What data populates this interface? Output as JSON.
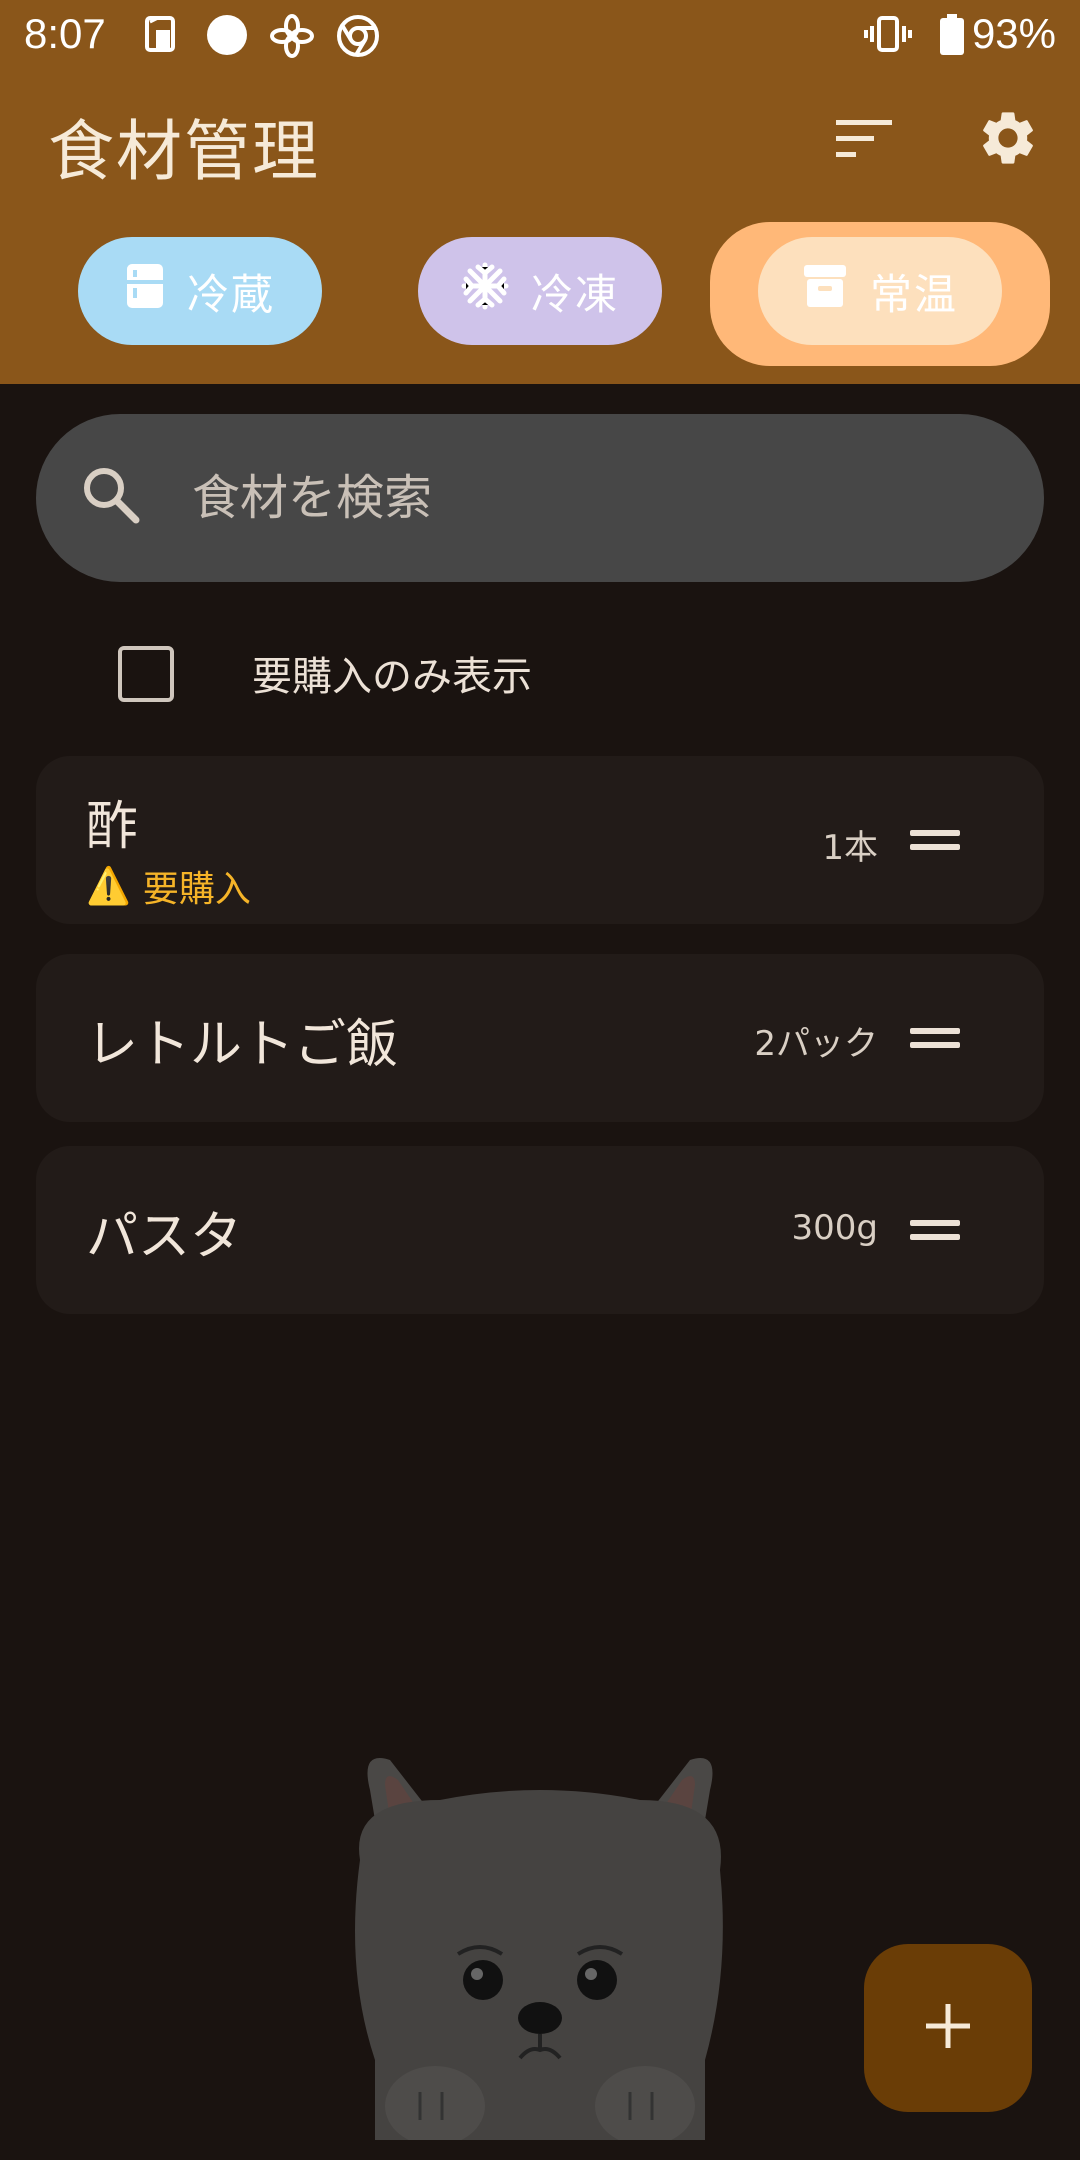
{
  "status_bar": {
    "time": "8:07",
    "battery": "93%",
    "icons": [
      "sim-card-icon",
      "circle-icon",
      "fan-icon",
      "chrome-icon",
      "vibrate-icon",
      "battery-icon"
    ]
  },
  "app_bar": {
    "title": "食材管理",
    "icons": [
      "sort-icon",
      "gear-icon"
    ]
  },
  "storage_tabs": [
    {
      "label": "冷蔵",
      "icon": "fridge-icon",
      "color": "#a9dbf5",
      "selected": false
    },
    {
      "label": "冷凍",
      "icon": "snowflake-icon",
      "color": "#cfc3ea",
      "selected": false
    },
    {
      "label": "常温",
      "icon": "archive-box-icon",
      "color": "#fde0bd",
      "selected": true
    }
  ],
  "search": {
    "placeholder": "食材を検索",
    "value": ""
  },
  "filter": {
    "label": "要購入のみ表示",
    "checked": false
  },
  "items": [
    {
      "name": "酢",
      "quantity": "1本",
      "warning_icon": "⚠️",
      "warning": "要購入"
    },
    {
      "name": "レトルトご飯",
      "quantity": "2パック"
    },
    {
      "name": "パスタ",
      "quantity": "300g"
    }
  ],
  "fab": {
    "label": "+",
    "icon": "plus-icon"
  },
  "colors": {
    "app_bar": "#8a561a",
    "background": "#1a1310",
    "card": "#221b18",
    "warning": "#f5b428",
    "fab": "#6a3d06"
  }
}
